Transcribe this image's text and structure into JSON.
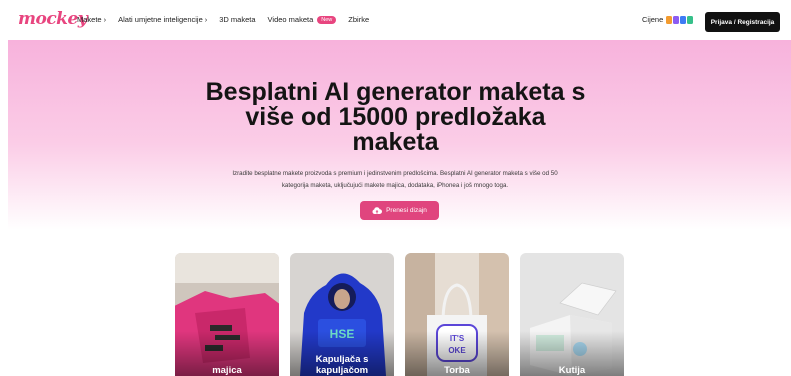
{
  "nav": {
    "logo": "mockey",
    "menu": [
      {
        "label": "Makete",
        "chevron": "›"
      },
      {
        "label": "Alati umjetne inteligencije",
        "chevron": "›"
      },
      {
        "label": "3D maketa"
      },
      {
        "label": "Video maketa",
        "badge": "New"
      },
      {
        "label": "Zbirke"
      }
    ],
    "pricing_label": "Cijene",
    "login_label": "Prijava / Registracija"
  },
  "hero": {
    "title_lines": [
      "Besplatni AI generator maketa s",
      "više od 15000 predložaka",
      "maketa"
    ],
    "desc_lines": [
      "Izradite besplatne makete proizvoda s premium i jedinstvenim predlošcima. Besplatni AI generator maketa s više od 50",
      "kategorija maketa, uključujući makete majica, dodataka, iPhonea i još mnogo toga."
    ],
    "upload_label": "Prenesi dizajn"
  },
  "cards": [
    {
      "label_lines": [
        "majica"
      ]
    },
    {
      "label_lines": [
        "Kapuljača s",
        "kapuljačom"
      ]
    },
    {
      "label_lines": [
        "Torba"
      ]
    },
    {
      "label_lines": [
        "Kutija"
      ]
    }
  ],
  "colors": {
    "accent": "#e0457e",
    "hero_pink": "#f7b2dc"
  }
}
